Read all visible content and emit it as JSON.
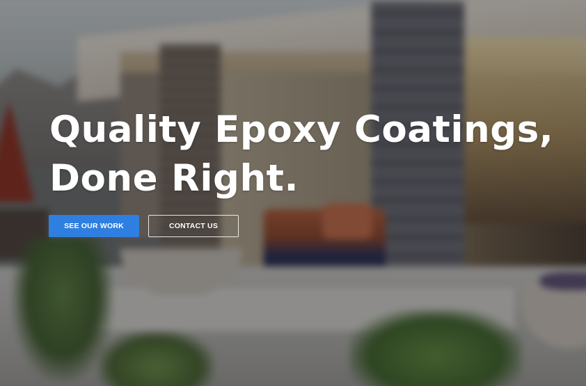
{
  "hero": {
    "headline_line1": "Quality Epoxy Coatings,",
    "headline_line2": "Done Right.",
    "primary_button_label": "SEE OUR WORK",
    "secondary_button_label": "CONTACT US"
  },
  "colors": {
    "primary_button": "#2f7fe0",
    "headline_text": "#ffffff",
    "overlay": "rgba(20, 22, 26, 0.38)"
  }
}
